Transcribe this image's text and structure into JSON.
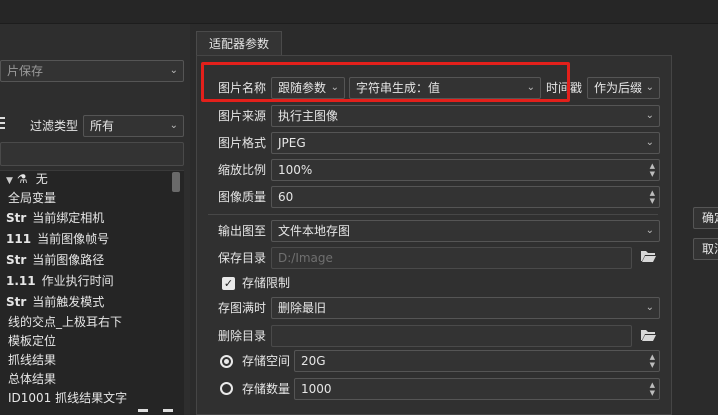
{
  "left": {
    "save_combo": "片保存",
    "filter_label": "过滤类型",
    "filter_value": "所有",
    "list_items": [
      {
        "icon": "flask-icon",
        "text": "无"
      },
      {
        "tag": "",
        "text": "全局变量"
      },
      {
        "tag": "Str",
        "text": "当前绑定相机"
      },
      {
        "tag": "111",
        "text": "当前图像帧号"
      },
      {
        "tag": "Str",
        "text": "当前图像路径"
      },
      {
        "tag": "1.11",
        "text": "作业执行时间"
      },
      {
        "tag": "Str",
        "text": "当前触发模式"
      },
      {
        "tag": "",
        "text": "线的交点_上极耳右下"
      },
      {
        "tag": "",
        "text": "模板定位"
      },
      {
        "tag": "",
        "text": "抓线结果"
      },
      {
        "tag": "",
        "text": "总体结果"
      },
      {
        "tag": "",
        "text": "ID1001 抓线结果文字"
      }
    ]
  },
  "tab": "适配器参数",
  "form": {
    "image_name_label": "图片名称",
    "image_name_mode": "跟随参数",
    "string_gen": "字符串生成：值",
    "time_label": "时间戳",
    "time_value": "作为后缀",
    "source_label": "图片来源",
    "source_value": "执行主图像",
    "format_label": "图片格式",
    "format_value": "JPEG",
    "scale_label": "缩放比例",
    "scale_value": "100%",
    "quality_label": "图像质量",
    "quality_value": "60",
    "output_label": "输出图至",
    "output_value": "文件本地存图",
    "save_dir_label": "保存目录",
    "save_dir_placeholder": "D:/Image",
    "storage_limit_label": "存储限制",
    "full_label": "存图满时",
    "full_value": "删除最旧",
    "delete_dir_label": "删除目录",
    "delete_dir_value": "",
    "space_label": "存储空间",
    "space_value": "20G",
    "count_label": "存储数量",
    "count_value": "1000"
  },
  "buttons": {
    "confirm": "确定",
    "cancel": "取消"
  }
}
